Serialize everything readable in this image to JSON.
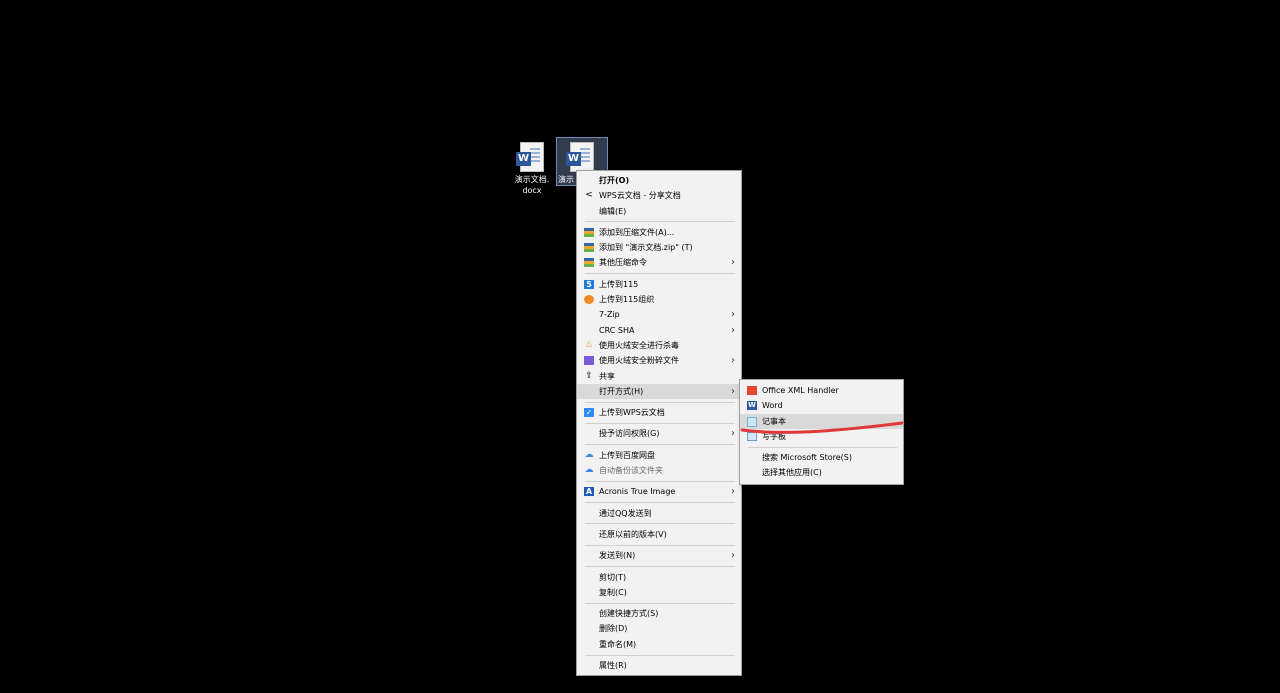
{
  "desktop": {
    "icons": [
      {
        "label_line1": "演示文档.",
        "label_line2": "docx",
        "glyph": "W"
      },
      {
        "label_line1": "演示",
        "label_line2": "",
        "glyph": "W"
      }
    ]
  },
  "context_menu": {
    "items": [
      {
        "label": "打开(O)",
        "icon": ""
      },
      {
        "label": "WPS云文档 - 分享文档",
        "icon": "share-icon"
      },
      {
        "label": "编辑(E)",
        "icon": ""
      },
      {
        "label": "添加到压缩文件(A)...",
        "icon": "winrar-icon"
      },
      {
        "label": "添加到 \"演示文档.zip\" (T)",
        "icon": "winrar-icon"
      },
      {
        "label": "其他压缩命令",
        "icon": "winrar-icon"
      },
      {
        "label": "上传到115",
        "icon": "115-icon"
      },
      {
        "label": "上传到115组织",
        "icon": "115-org-icon"
      },
      {
        "label": "7-Zip",
        "icon": ""
      },
      {
        "label": "CRC SHA",
        "icon": ""
      },
      {
        "label": "使用火绒安全进行杀毒",
        "icon": "huorong-icon"
      },
      {
        "label": "使用火绒安全粉碎文件",
        "icon": "shredder-icon"
      },
      {
        "label": "共享",
        "icon": "share-out-icon"
      },
      {
        "label": "打开方式(H)",
        "icon": ""
      },
      {
        "label": "上传到WPS云文档",
        "icon": "wps-cloud-icon"
      },
      {
        "label": "授予访问权限(G)",
        "icon": ""
      },
      {
        "label": "上传到百度网盘",
        "icon": "baidu-cloud-icon"
      },
      {
        "label": "自动备份该文件夹",
        "icon": "baidu-cloud-icon"
      },
      {
        "label": "Acronis True Image",
        "icon": "acronis-icon"
      },
      {
        "label": "通过QQ发送到",
        "icon": ""
      },
      {
        "label": "还原以前的版本(V)",
        "icon": ""
      },
      {
        "label": "发送到(N)",
        "icon": ""
      },
      {
        "label": "剪切(T)",
        "icon": ""
      },
      {
        "label": "复制(C)",
        "icon": ""
      },
      {
        "label": "创建快捷方式(S)",
        "icon": ""
      },
      {
        "label": "删除(D)",
        "icon": ""
      },
      {
        "label": "重命名(M)",
        "icon": ""
      },
      {
        "label": "属性(R)",
        "icon": ""
      }
    ]
  },
  "open_with_submenu": {
    "items": [
      {
        "label": "Office XML Handler",
        "icon": "office-icon"
      },
      {
        "label": "Word",
        "icon": "word-icon"
      },
      {
        "label": "记事本",
        "icon": "notepad-icon"
      },
      {
        "label": "写字板",
        "icon": "wordpad-icon"
      },
      {
        "label": "搜索 Microsoft Store(S)",
        "icon": ""
      },
      {
        "label": "选择其他应用(C)",
        "icon": ""
      }
    ]
  },
  "annotation": {
    "color": "#e0393a"
  }
}
